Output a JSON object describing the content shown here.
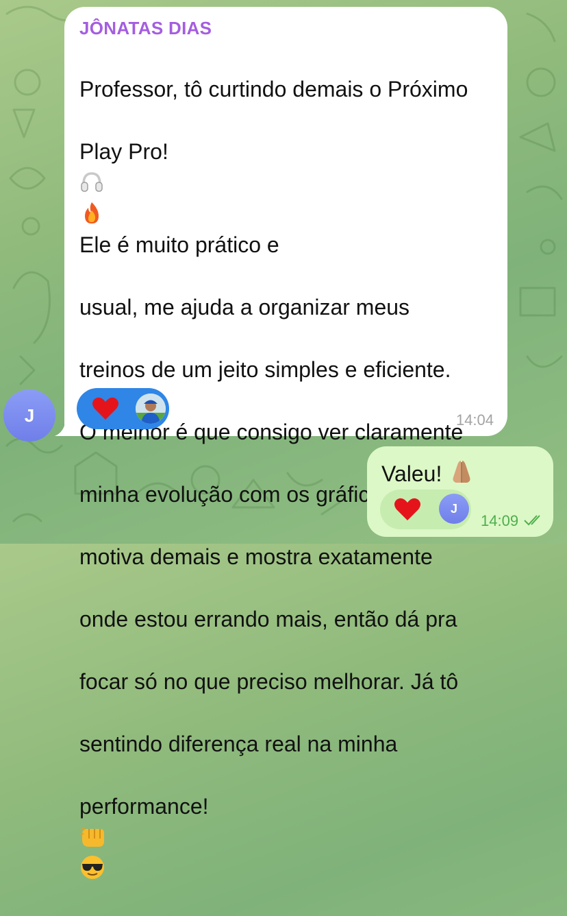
{
  "chat": {
    "incoming": {
      "sender": "JÔNATAS DIAS",
      "avatar_initial": "J",
      "lines": [
        "Professor, tô curtindo demais o Próximo",
        "Play Pro!",
        "Ele é muito prático e",
        "usual, me ajuda a organizar meus",
        "treinos de um jeito simples e eficiente.",
        "O melhor é que consigo ver claramente",
        "minha evolução com os gráficos, isso",
        "motiva demais e mostra exatamente",
        "onde estou errando mais, então dá pra",
        "focar só no que preciso melhorar. Já tô",
        "sentindo diferença real na minha",
        "performance!"
      ],
      "emojis_line2": [
        "headphones-emoji",
        "fire-emoji"
      ],
      "emojis_last": [
        "fist-bump-emoji",
        "sunglasses-emoji"
      ],
      "reactions": [
        "heart-reaction",
        "reactor-profile-photo"
      ],
      "time": "14:04"
    },
    "outgoing": {
      "text": "Valeu!",
      "emoji": "folded-hands-emoji",
      "reactions": [
        "heart-reaction"
      ],
      "reactor_initial": "J",
      "time": "14:09",
      "status": "read-double-check"
    }
  },
  "colors": {
    "sender_name": "#a45ee0",
    "reaction_pill_in": "#2f86e6",
    "outgoing_bubble": "#dcf8c6",
    "time_out": "#4fae4e",
    "avatar": "#7b8cf0"
  }
}
